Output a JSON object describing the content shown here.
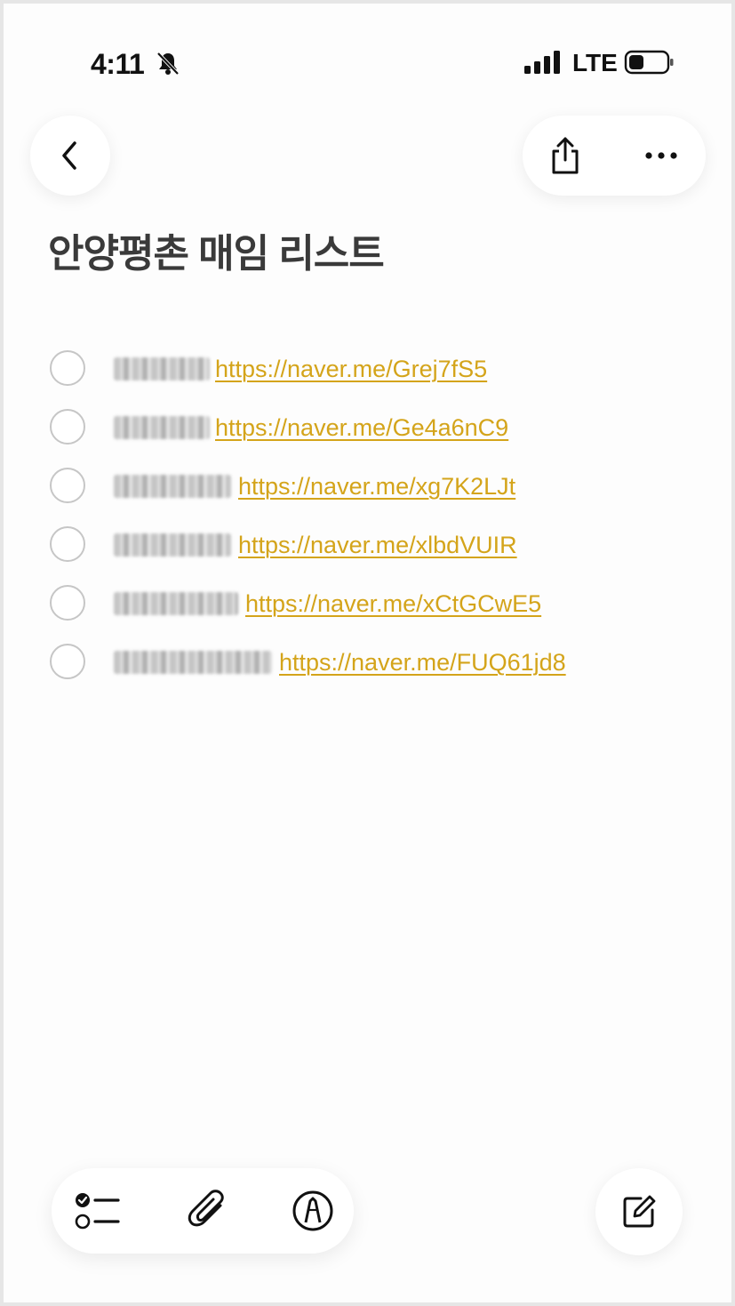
{
  "status_bar": {
    "time": "4:11",
    "network": "LTE",
    "icons": [
      "bell-slash-icon",
      "signal-icon",
      "battery-icon"
    ]
  },
  "nav": {
    "icons": [
      "chevron-left-icon",
      "share-icon",
      "more-icon"
    ]
  },
  "note": {
    "title": "안양평촌 매임 리스트"
  },
  "checklist": [
    {
      "checked": false,
      "link": "https://naver.me/Grej7fS5"
    },
    {
      "checked": false,
      "link": "https://naver.me/Ge4a6nC9"
    },
    {
      "checked": false,
      "link": "https://naver.me/xg7K2LJt"
    },
    {
      "checked": false,
      "link": "https://naver.me/xlbdVUIR"
    },
    {
      "checked": false,
      "link": "https://naver.me/xCtGCwE5"
    },
    {
      "checked": false,
      "link": "https://naver.me/FUQ61jd8"
    }
  ],
  "toolbar": {
    "icons": [
      "checklist-icon",
      "paperclip-icon",
      "markup-pen-icon",
      "compose-icon"
    ]
  },
  "colors": {
    "link": "#d4a41a",
    "title": "#3a3a3a",
    "checkbox_border": "#c6c6c6"
  }
}
